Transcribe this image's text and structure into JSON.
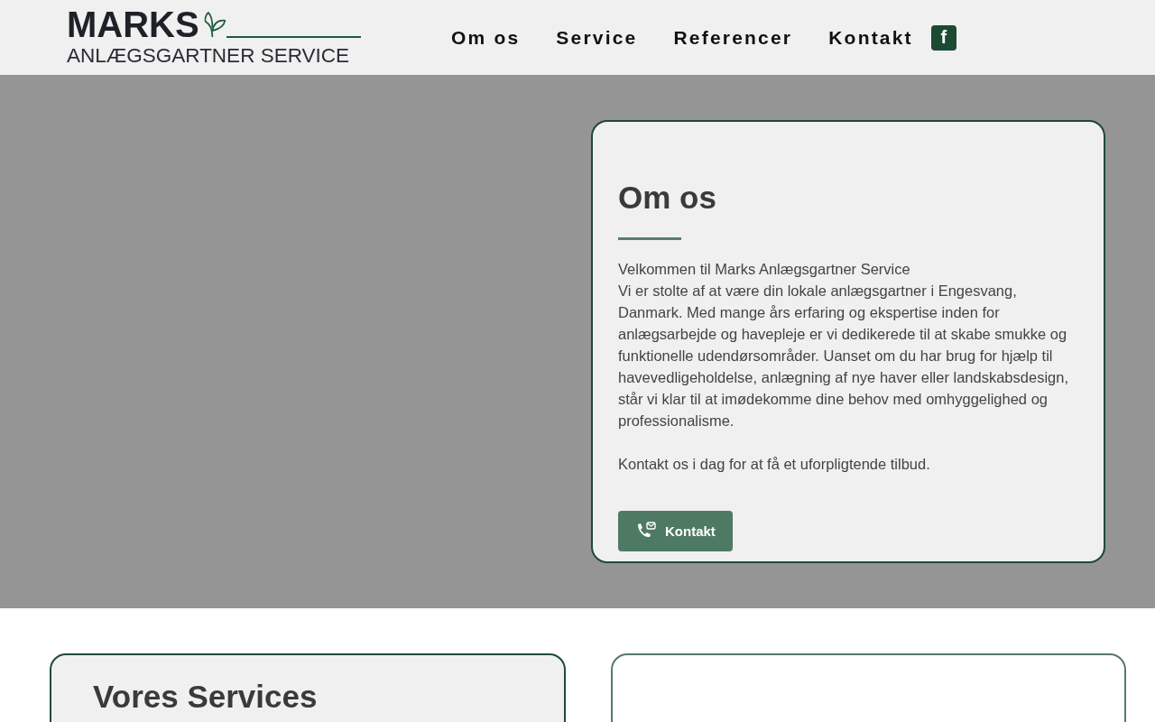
{
  "logo": {
    "name": "MARKS",
    "tagline": "ANLÆGSGARTNER SERVICE"
  },
  "nav": {
    "items": [
      {
        "label": "Om os"
      },
      {
        "label": "Service"
      },
      {
        "label": "Referencer"
      },
      {
        "label": "Kontakt"
      }
    ],
    "facebook": "f"
  },
  "about": {
    "title": "Om os",
    "lines": [
      "Velkommen til Marks Anlægsgartner Service",
      "Vi er stolte af at være din lokale anlægsgartner i Engesvang, Danmark. Med mange års erfaring og ekspertise inden for anlægsarbejde og havepleje er vi dedikerede til at skabe smukke og funktionelle udendørsområder. Uanset om du har brug for hjælp til havevedligeholdelse, anlægning af nye haver eller landskabsdesign, står vi klar til at imødekomme dine behov med omhyggelighed og professionalisme."
    ],
    "cta": "Kontakt os i dag for at få et uforpligtende tilbud.",
    "button": "Kontakt"
  },
  "services": {
    "title": "Vores Services"
  }
}
